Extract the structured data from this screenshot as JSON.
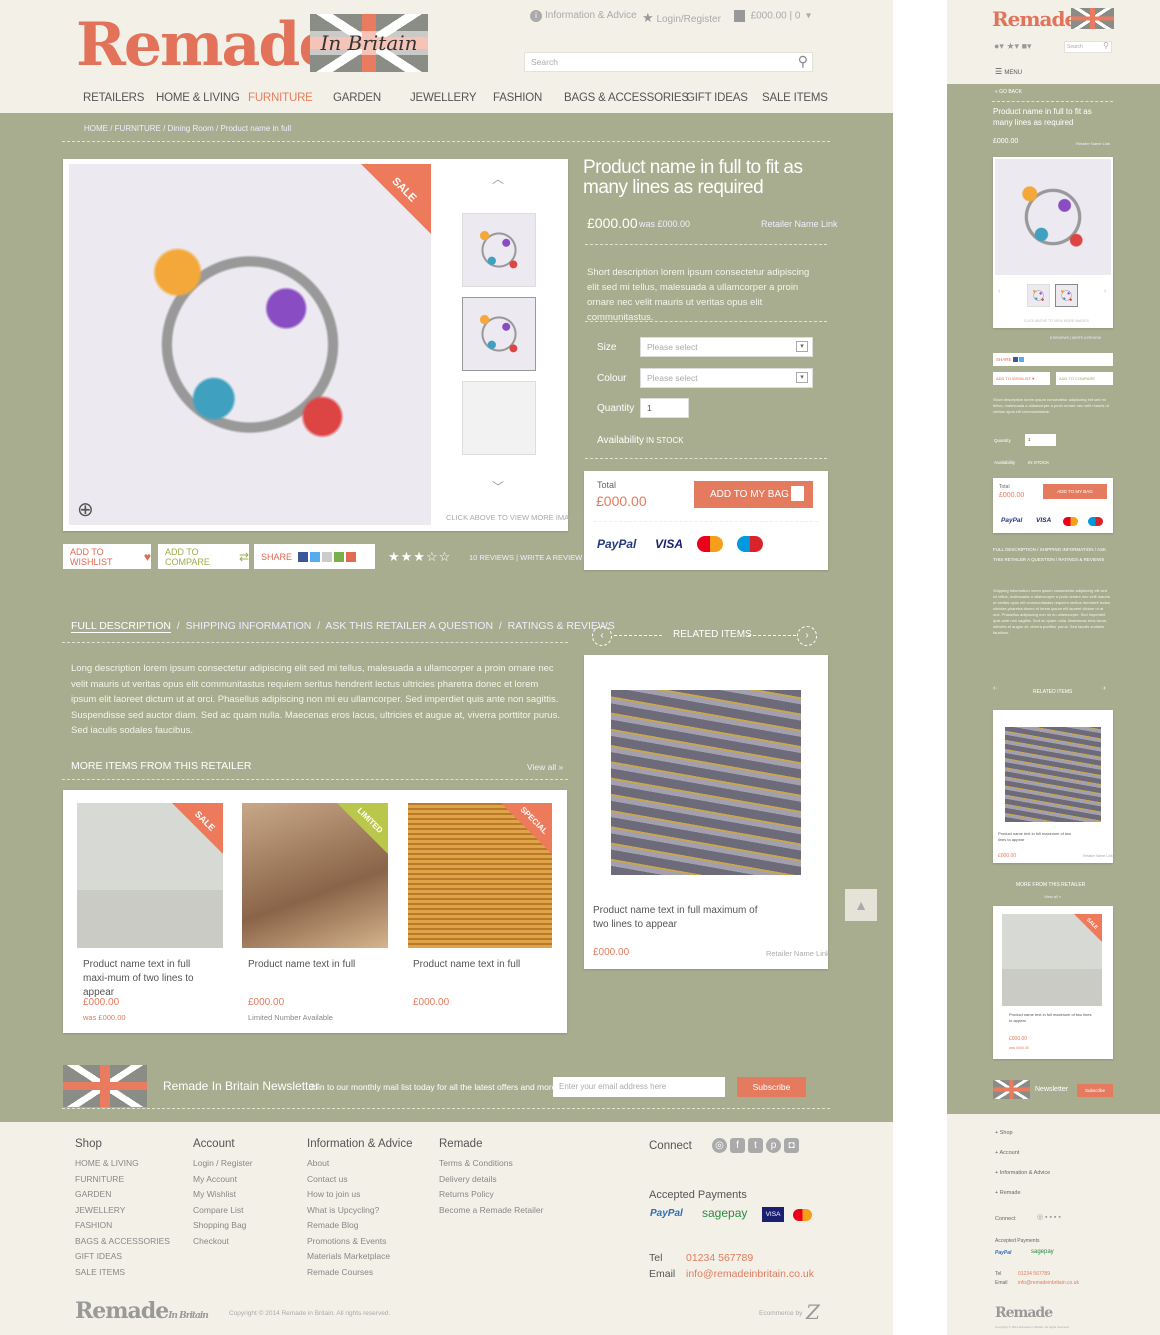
{
  "brand": {
    "logo_text_main": "Remade",
    "logo_text_sub": "In Britain"
  },
  "header": {
    "info_link": "Information & Advice",
    "login_link": "Login/Register",
    "bag_summary": "£000.00 | 0",
    "search_placeholder": "Search"
  },
  "nav": [
    "RETAILERS",
    "HOME & LIVING",
    "FURNITURE",
    "GARDEN",
    "JEWELLERY",
    "FASHION",
    "BAGS & ACCESSORIES",
    "GIFT IDEAS",
    "SALE ITEMS"
  ],
  "nav_active": "FURNITURE",
  "breadcrumb": "HOME / FURNITURE / Dining Room / Product name in full",
  "product": {
    "title": "Product name in full to fit as many lines as required",
    "price": "£000.00",
    "was": "was £000.00",
    "retailer_link": "Retailer Name Link",
    "short_desc": "Short description lorem ipsum consectetur adipiscing elit sed mi tellus, malesuada a ullamcorper a proin ornare nec velit mauris ut veritas opus elit communitastus.",
    "sale_badge": "SALE",
    "size_label": "Size",
    "size_placeholder": "Please select",
    "colour_label": "Colour",
    "colour_placeholder": "Please select",
    "quantity_label": "Quantity",
    "quantity_value": "1",
    "availability_label": "Availability",
    "availability_value": "IN STOCK",
    "total_label": "Total",
    "total_value": "£000.00",
    "add_to_bag": "ADD TO MY BAG",
    "view_more": "CLICK ABOVE TO VIEW MORE IMAGES",
    "wishlist": "ADD TO WISHLIST",
    "compare": "ADD TO COMPARE",
    "share": "SHARE",
    "reviews": "10 REVIEWS",
    "write_review": "WRITE A REVIEW",
    "payments": [
      "PayPal",
      "VISA",
      "MasterCard",
      "Maestro"
    ]
  },
  "tabs": [
    "FULL DESCRIPTION",
    "SHIPPING INFORMATION",
    "ASK THIS RETAILER A QUESTION",
    "RATINGS & REVIEWS"
  ],
  "long_desc": "Long description lorem ipsum consectetur adipiscing elit sed mi tellus, malesuada a ullamcorper a proin ornare nec velit mauris ut veritas opus elit communitastus requiem seritus hendrerit lectus ultricies pharetra donec et lorem ipsum elit laoreet dictum ut at orci. Phasellus adipiscing non mi eu ullamcorper. Sed imperdiet quis ante non sagittis. Suspendisse sed auctor diam. Sed ac quam nulla. Maecenas eros lacus, ultricies et augue at, viverra porttitor purus. Sed iaculis sodales faucibus.",
  "more_items": {
    "heading": "MORE ITEMS FROM THIS RETAILER",
    "view_all": "View all »",
    "items": [
      {
        "badge": "SALE",
        "name": "Product name text in full maxi-mum of two lines to appear",
        "price": "£000.00",
        "extra": "was £000.00"
      },
      {
        "badge": "LIMITED",
        "name": "Product name text in full",
        "price": "£000.00",
        "extra": "Limited Number Available"
      },
      {
        "badge": "SPECIAL",
        "name": "Product name text in full",
        "price": "£000.00",
        "extra": ""
      }
    ]
  },
  "related": {
    "heading": "RELATED ITEMS",
    "name": "Product name text in full maximum of two lines to appear",
    "price": "£000.00",
    "retailer": "Retailer Name Link"
  },
  "newsletter": {
    "title": "Remade In Britain Newsletter",
    "text": "Join to our monthly mail list today for all the latest offers and more",
    "placeholder": "Enter your email address here",
    "button": "Subscribe"
  },
  "footer": {
    "shop": {
      "title": "Shop",
      "items": [
        "HOME & LIVING",
        "FURNITURE",
        "GARDEN",
        "JEWELLERY",
        "FASHION",
        "BAGS & ACCESSORIES",
        "GIFT IDEAS",
        "SALE ITEMS"
      ]
    },
    "account": {
      "title": "Account",
      "items": [
        "Login / Register",
        "My Account",
        "My Wishlist",
        "Compare List",
        "Shopping Bag",
        "Checkout"
      ]
    },
    "info": {
      "title": "Information & Advice",
      "items": [
        "About",
        "Contact us",
        "How to join us",
        "What is Upcycling?",
        "Remade Blog",
        "Promotions & Events",
        "Materials Marketplace",
        "Remade Courses"
      ]
    },
    "remade": {
      "title": "Remade",
      "items": [
        "Terms & Conditions",
        "Delivery details",
        "Returns Policy",
        "Become a Remade Retailer"
      ]
    },
    "connect": "Connect",
    "accepted": "Accepted Payments",
    "pay": [
      "PayPal",
      "sagepay",
      "VISA"
    ],
    "tel_label": "Tel",
    "tel": "01234 567789",
    "email_label": "Email",
    "email": "info@remadeinbritain.co.uk",
    "copyright": "Copyright © 2014 Remade in Britain. All rights reserved.",
    "ecommerce": "Ecommerce by"
  },
  "mobile": {
    "menu": "MENU",
    "go_back": "« GO BACK",
    "title": "Product name in full to fit as many lines as required",
    "price": "£000.00",
    "retailer": "Retailer Name Link",
    "click_more": "CLICK ABOVE TO VIEW MORE IMAGES",
    "reviews": "8 REVIEWS | WRITE A REVIEW",
    "share": "SHARE",
    "wishlist": "ADD TO WISHLIST",
    "compare": "ADD TO COMPARE",
    "short_desc": "Short description lorem ipsum consectetur adipiscing elit sed mi tellus, malesuada a ullamcorper a proin ornare nec velit mauris ut veritas opus elit communitastus.",
    "quantity": "Quantity",
    "qty_val": "1",
    "availability": "Availability",
    "avail_val": "IN STOCK",
    "total": "Total",
    "total_val": "£000.00",
    "add": "ADD TO MY BAG",
    "tabs": "FULL DESCRIPTION / SHIPPING INFORMATION / ASK THIS RETAILER A QUESTION / RATINGS & REVIEWS",
    "ship_text": "Shipping Information lorem ipsum consectetur adipiscing elit sed mi tellus, malesuada a ullamcorper a proin ornare nec velit mauris ut veritas opus elit communitastus requiem seritus hendrerit lectus ultricies pharetra donec et lorem ipsum elit laoreet dictum ut at orci. Phasellus adipiscing non mi eu ullamcorper. Sed imperdiet quis ante non sagittis. Sed ac quam nulla. Maecenas eros lacus, ultricies et augue at, viverra porttitor purus. Sed iaculis sodales faucibus.",
    "related": "RELATED ITEMS",
    "rel_name": "Product name text in full maximum of two lines to appear",
    "rel_price": "£000.00",
    "rel_ret": "Retailer Name Link",
    "more": "MORE FROM THIS RETAILER",
    "view_all": "View all »",
    "more_name": "Product name text in full maximum of two lines to appear",
    "more_price": "£000.00",
    "more_was": "was £000.00",
    "news": "Newsletter",
    "sub": "Subscribe",
    "f_shop": "Shop",
    "f_account": "Account",
    "f_info": "Information & Advice",
    "f_remade": "Remade",
    "connect": "Connect",
    "accepted": "Accepted Payments",
    "tel_l": "Tel",
    "tel": "01234 567789",
    "email_l": "Email",
    "email": "info@remadeinbritain.co.uk",
    "copy": "Copyright © 2014 Remade in Britain. All rights reserved.",
    "search": "Search"
  }
}
